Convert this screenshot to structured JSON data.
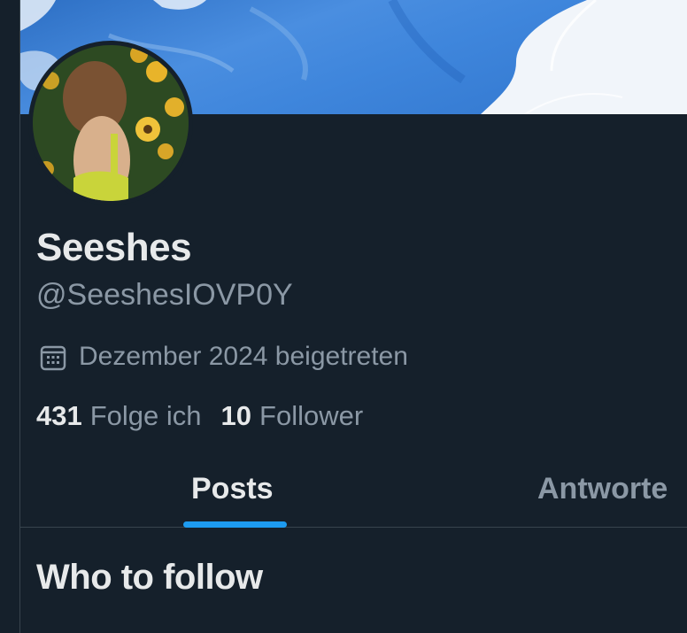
{
  "profile": {
    "name": "Seeshes",
    "handle": "@SeeshesIOVP0Y",
    "joined": "Dezember 2024 beigetreten",
    "stats": {
      "following_count": "431",
      "following_label": "Folge ich",
      "followers_count": "10",
      "followers_label": "Follower"
    }
  },
  "icons": {
    "joined": "calendar-icon"
  },
  "tabs": [
    {
      "label": "Posts",
      "active": true
    },
    {
      "label": "Antworte",
      "active": false
    }
  ],
  "sections": {
    "who_to_follow": "Who to follow"
  },
  "colors": {
    "background": "#15202b",
    "text_primary": "#e7e9ea",
    "text_secondary": "#8b98a5",
    "accent": "#1d9bf0",
    "border": "#38444d"
  }
}
